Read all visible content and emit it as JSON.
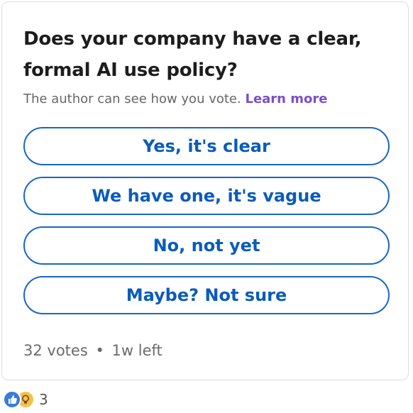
{
  "poll": {
    "question": "Does your company have a clear, formal AI use policy?",
    "visibility_notice": "The author can see how you vote.",
    "learn_more_label": "Learn more",
    "options": [
      {
        "label": "Yes, it's clear"
      },
      {
        "label": "We have one, it's vague"
      },
      {
        "label": "No, not yet"
      },
      {
        "label": "Maybe? Not sure"
      }
    ],
    "votes": "32 votes",
    "separator": "•",
    "time_left": "1w left"
  },
  "reactions": {
    "icons": [
      "like-icon",
      "insightful-icon"
    ],
    "count": "3"
  },
  "colors": {
    "accent": "#0b5cba",
    "learn_more": "#7b4fc8",
    "like": "#3b7bd8",
    "insightful": "#f2c14e"
  }
}
